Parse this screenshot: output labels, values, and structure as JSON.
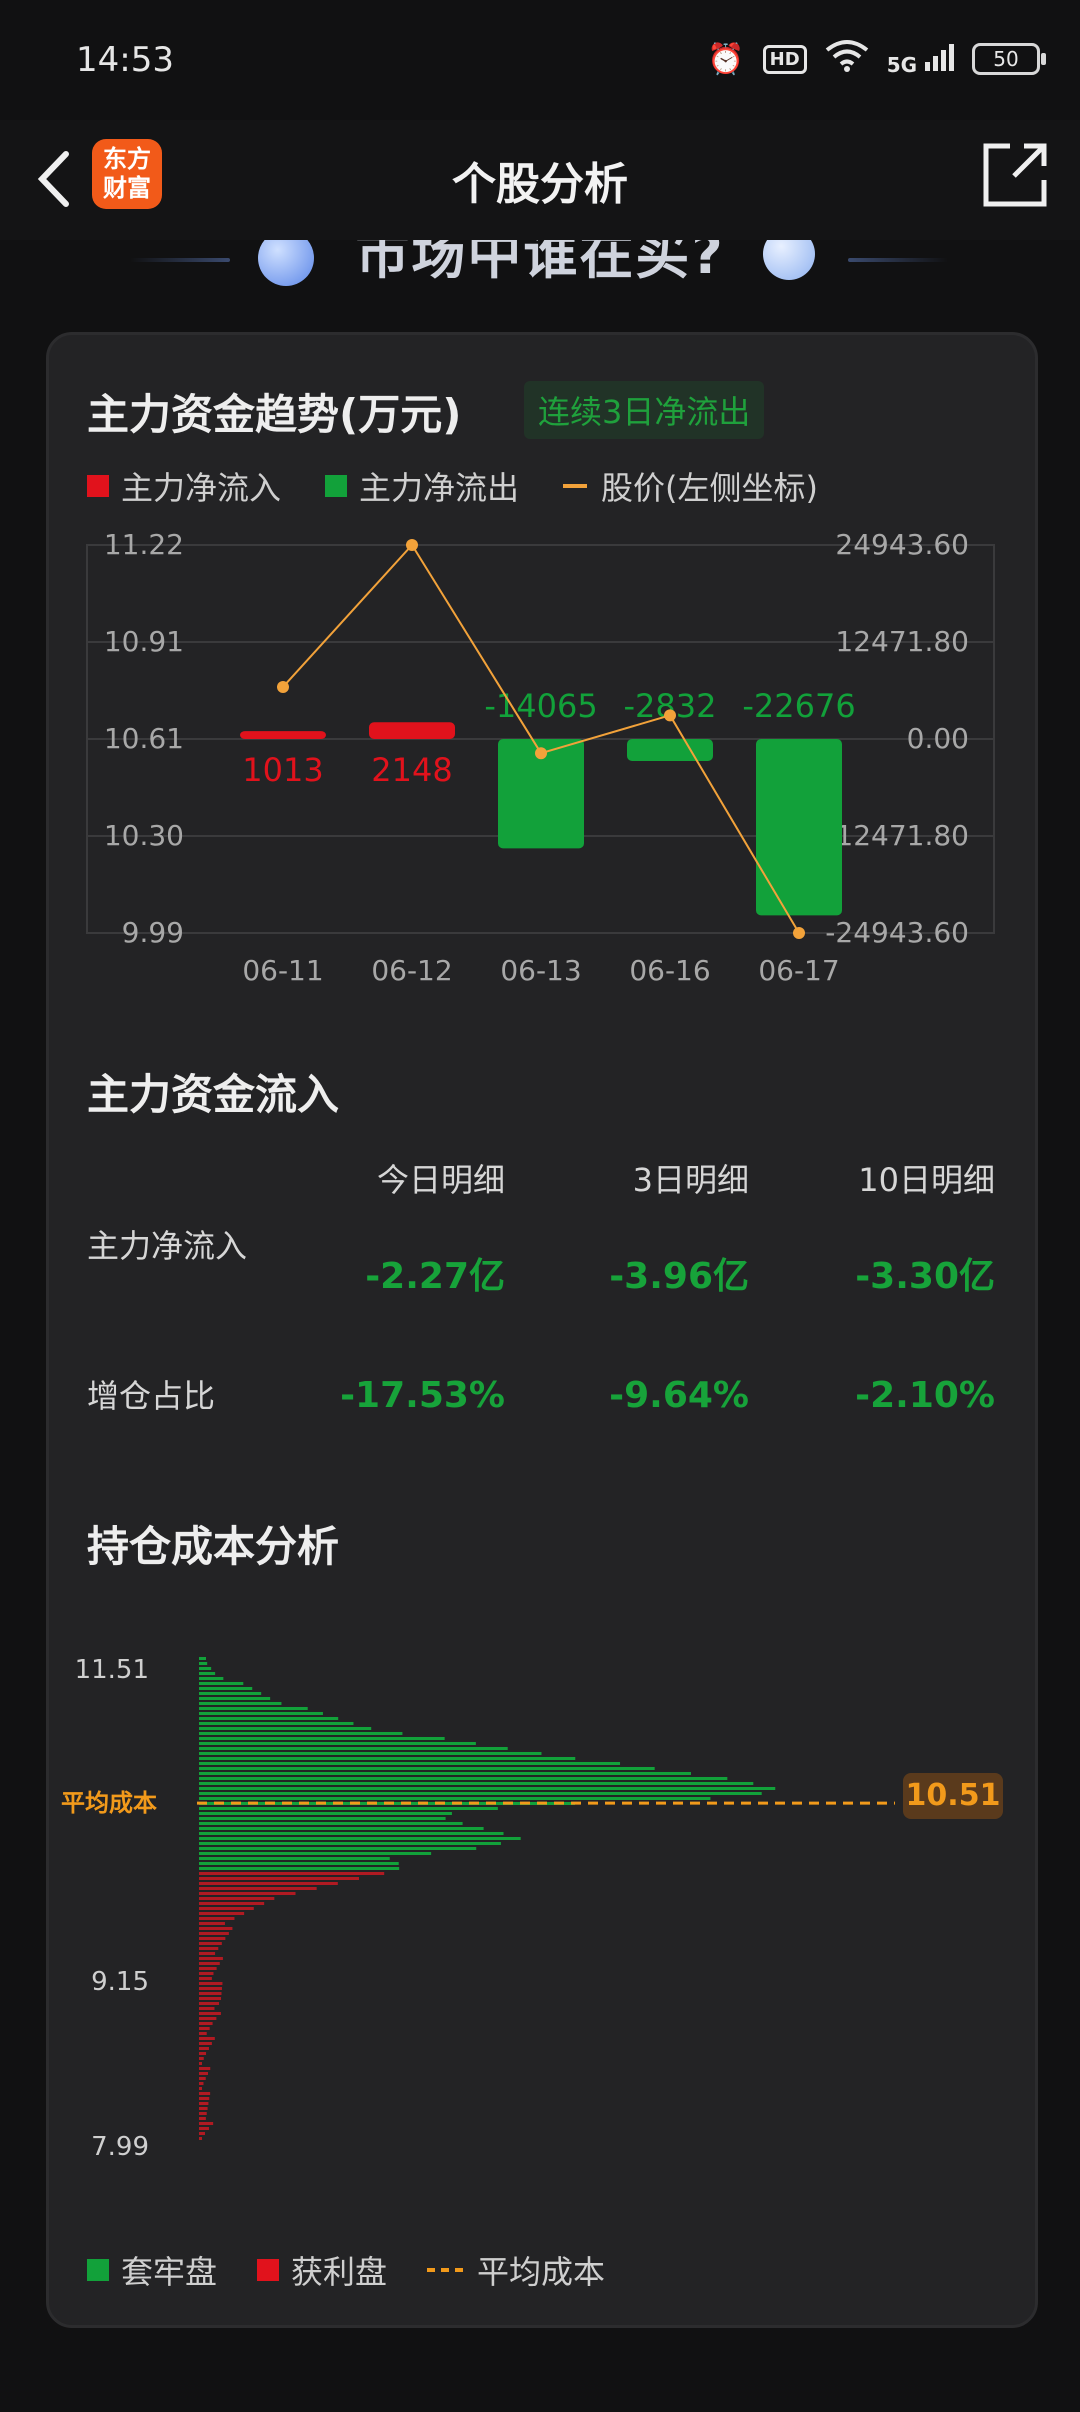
{
  "status_bar": {
    "time": "14:53",
    "hd": "HD",
    "signal": "5G",
    "battery": "50"
  },
  "nav": {
    "logo_line1": "东方",
    "logo_line2": "财富",
    "title": "个股分析"
  },
  "banner": {
    "text": "市场中谁在买?"
  },
  "trend": {
    "title": "主力资金趋势(万元)",
    "badge": "连续3日净流出",
    "legend": {
      "inflow": "主力净流入",
      "outflow": "主力净流出",
      "price": "股价(左侧坐标)"
    }
  },
  "chart_data": [
    {
      "type": "bar",
      "title": "主力资金趋势(万元)",
      "categories": [
        "06-11",
        "06-12",
        "06-13",
        "06-16",
        "06-17"
      ],
      "series": [
        {
          "name": "主力净流入/净流出",
          "axis": "right",
          "values": [
            1013,
            2148,
            -14065,
            -2832,
            -22676
          ]
        },
        {
          "name": "股价(左侧坐标)",
          "type": "line",
          "axis": "left",
          "values": [
            10.77,
            11.22,
            10.56,
            10.68,
            9.99
          ]
        }
      ],
      "left_ticks": [
        "11.22",
        "10.91",
        "10.61",
        "10.30",
        "9.99"
      ],
      "right_ticks": [
        "24943.60",
        "12471.80",
        "0.00",
        "-12471.80",
        "-24943.60"
      ],
      "left_ylim": [
        9.99,
        11.22
      ],
      "right_ylim": [
        -24943.6,
        24943.6
      ],
      "colors": {
        "inflow": "#e1121c",
        "outflow": "#12a13a",
        "price": "#f2a23a"
      },
      "grid": true
    },
    {
      "type": "bar",
      "title": "持仓成本分析",
      "orientation": "horizontal",
      "ticks": [
        "11.51",
        "9.15",
        "7.99"
      ],
      "avg_cost": 10.51,
      "series_names": [
        "套牢盘",
        "获利盘"
      ]
    }
  ],
  "flow": {
    "title": "主力资金流入",
    "headers": [
      "今日明细",
      "3日明细",
      "10日明细"
    ],
    "rows": [
      {
        "label": "主力净流入",
        "values": [
          "-2.27亿",
          "-3.96亿",
          "-3.30亿"
        ]
      },
      {
        "label": "增仓占比",
        "values": [
          "-17.53%",
          "-9.64%",
          "-2.10%"
        ]
      }
    ]
  },
  "cost": {
    "title": "持仓成本分析",
    "ticks": [
      "11.51",
      "9.15",
      "7.99"
    ],
    "avg_label": "平均成本",
    "avg_value": "10.51",
    "legend": {
      "trapped": "套牢盘",
      "profit": "获利盘",
      "avg": "平均成本"
    }
  }
}
